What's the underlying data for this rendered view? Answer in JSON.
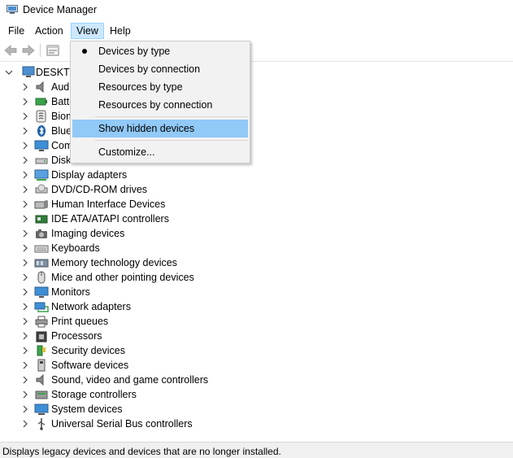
{
  "window": {
    "title": "Device Manager"
  },
  "menubar": {
    "file": "File",
    "action": "Action",
    "view": "View",
    "help": "Help"
  },
  "view_menu": {
    "items": [
      {
        "label": "Devices by type",
        "checked": true
      },
      {
        "label": "Devices by connection"
      },
      {
        "label": "Resources by type"
      },
      {
        "label": "Resources by connection"
      },
      {
        "label": "Show hidden devices",
        "highlighted": true
      },
      {
        "label": "Customize..."
      }
    ]
  },
  "tree": {
    "root": "DESKTO",
    "items": [
      {
        "label": "Aud",
        "icon": "speaker-icon"
      },
      {
        "label": "Batte",
        "icon": "battery-icon"
      },
      {
        "label": "Biom",
        "icon": "fingerprint-icon"
      },
      {
        "label": "Blue",
        "icon": "bluetooth-icon"
      },
      {
        "label": "Com",
        "icon": "monitor-icon"
      },
      {
        "label": "Disk drives",
        "icon": "disk-drive-icon"
      },
      {
        "label": "Display adapters",
        "icon": "display-adapter-icon"
      },
      {
        "label": "DVD/CD-ROM drives",
        "icon": "dvd-icon"
      },
      {
        "label": "Human Interface Devices",
        "icon": "hid-icon"
      },
      {
        "label": "IDE ATA/ATAPI controllers",
        "icon": "ide-controller-icon"
      },
      {
        "label": "Imaging devices",
        "icon": "camera-icon"
      },
      {
        "label": "Keyboards",
        "icon": "keyboard-icon"
      },
      {
        "label": "Memory technology devices",
        "icon": "memory-icon"
      },
      {
        "label": "Mice and other pointing devices",
        "icon": "mouse-icon"
      },
      {
        "label": "Monitors",
        "icon": "monitor-icon"
      },
      {
        "label": "Network adapters",
        "icon": "network-adapter-icon"
      },
      {
        "label": "Print queues",
        "icon": "printer-icon"
      },
      {
        "label": "Processors",
        "icon": "processor-icon"
      },
      {
        "label": "Security devices",
        "icon": "security-device-icon"
      },
      {
        "label": "Software devices",
        "icon": "software-device-icon"
      },
      {
        "label": "Sound, video and game controllers",
        "icon": "speaker-icon"
      },
      {
        "label": "Storage controllers",
        "icon": "storage-controller-icon"
      },
      {
        "label": "System devices",
        "icon": "system-device-icon"
      },
      {
        "label": "Universal Serial Bus controllers",
        "icon": "usb-icon"
      }
    ]
  },
  "statusbar": {
    "text": "Displays legacy devices and devices that are no longer installed."
  },
  "colors": {
    "menu_hover": "#91c9f7",
    "menu_active": "#cce8ff",
    "accent": "#1e7bc4"
  }
}
